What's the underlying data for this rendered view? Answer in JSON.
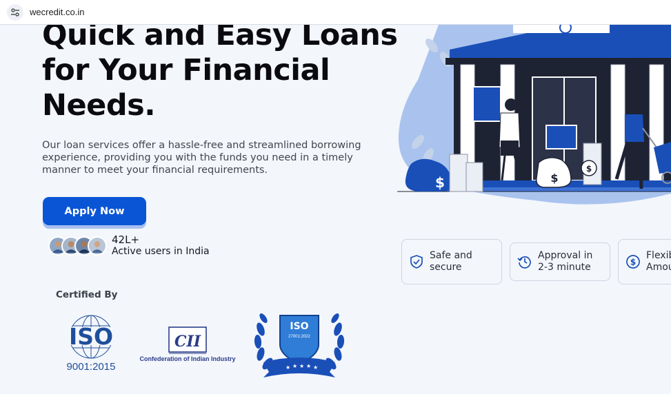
{
  "browser": {
    "url": "wecredit.co.in"
  },
  "hero": {
    "headline_line1": "Quick and Easy Loans",
    "headline_line2": "for Your Financial",
    "headline_line3": "Needs.",
    "description": "Our loan services offer a hassle-free and streamlined borrowing experience, providing you with the funds you need in a timely manner to meet your financial requirements.",
    "cta_label": "Apply Now"
  },
  "users": {
    "count": "42L+",
    "label": "Active users in India"
  },
  "certifications": {
    "heading": "Certified By",
    "iso_9001": {
      "text": "ISO",
      "number": "9001:2015"
    },
    "cii": {
      "abbr": "CII",
      "name": "Confederation of Indian Industry"
    },
    "iso_27001": {
      "text": "ISO",
      "number": "27001:2022"
    }
  },
  "features": [
    {
      "label": "Safe and\nsecure",
      "icon": "shield-check-icon"
    },
    {
      "label": "Approval in\n2-3 minute",
      "icon": "clock-history-icon"
    },
    {
      "label": "Flexibl\nAmou",
      "icon": "dollar-circle-icon"
    }
  ],
  "colors": {
    "accent": "#0a55d6",
    "illustration_blob": "#a9c3ee",
    "text_dark": "#0b0b0f"
  }
}
